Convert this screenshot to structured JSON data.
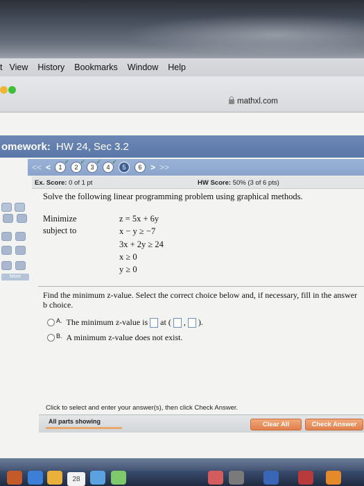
{
  "menubar": {
    "items": [
      "t",
      "View",
      "History",
      "Bookmarks",
      "Window",
      "Help"
    ]
  },
  "browser": {
    "url": "mathxl.com"
  },
  "homework": {
    "label": "omework:",
    "title": "HW 24, Sec 3.2"
  },
  "question_nav": {
    "prev_all": "<<",
    "prev": "<",
    "next": ">",
    "next_all": ">>",
    "questions": [
      {
        "num": "1",
        "status": "done"
      },
      {
        "num": "2",
        "status": "done"
      },
      {
        "num": "3",
        "status": "done"
      },
      {
        "num": "4",
        "status": "done"
      },
      {
        "num": "5",
        "status": "current"
      },
      {
        "num": "6",
        "status": "todo"
      }
    ]
  },
  "score": {
    "ex_label": "Ex. Score:",
    "ex_value": "0 of 1 pt",
    "hw_label": "HW Score:",
    "hw_value": "50% (3 of 6 pts)"
  },
  "question": {
    "prompt": "Solve the following linear programming problem using graphical methods.",
    "minimize_label": "Minimize",
    "subject_to_label": "subject to",
    "objective": "z = 5x + 6y",
    "constraints": [
      "x − y ≥ −7",
      "3x + 2y ≥ 24",
      "x ≥ 0",
      "y ≥ 0"
    ],
    "instruction": "Find the minimum z-value. Select the correct choice below and, if necessary, fill in the answer b choice.",
    "choices": [
      {
        "letter": "A.",
        "text_before": "The minimum z-value is",
        "text_mid": "at (",
        "text_comma": ",",
        "text_after": ")."
      },
      {
        "letter": "B.",
        "text": "A minimum z-value does not exist."
      }
    ]
  },
  "sidebar": {
    "more_label": "More"
  },
  "footer": {
    "hint": "Click to select and enter your answer(s), then click Check Answer.",
    "all_parts": "All parts showing",
    "clear_all": "Clear All",
    "check_answer": "Check Answer"
  },
  "dock": {
    "calendar_day": "28"
  }
}
